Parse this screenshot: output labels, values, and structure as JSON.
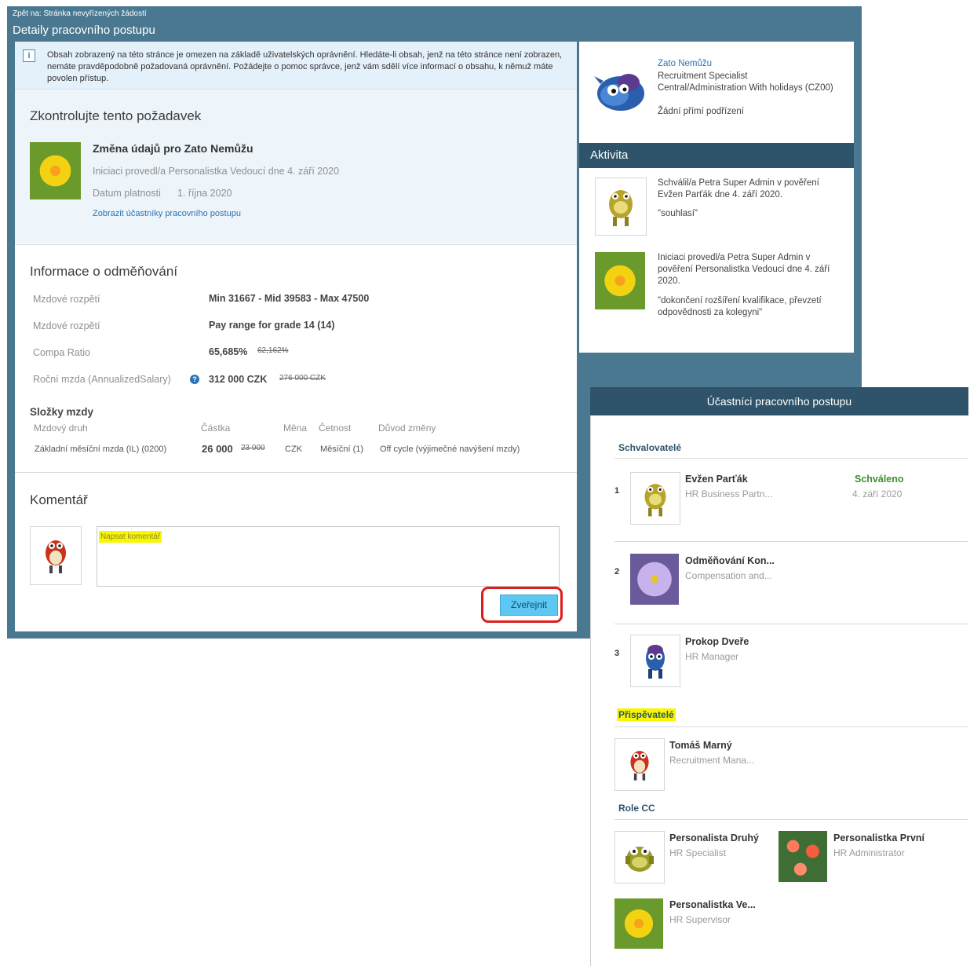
{
  "header": {
    "back": "Zpět na: Stránka nevyřízených žádostí",
    "title": "Detaily pracovního postupu"
  },
  "info": {
    "text": "Obsah zobrazený na této stránce je omezen na základě uživatelských oprávnění. Hledáte-li obsah, jenž na této stránce není zobrazen, nemáte pravděpodobně požadovaná oprávnění. Požádejte o pomoc správce, jenž vám sdělí více informací o obsahu, k němuž máte povolen přístup."
  },
  "review": {
    "title": "Zkontrolujte tento požadavek",
    "request": "Změna údajů pro Zato Nemůžu",
    "initiated": "Iniciaci provedl/a Personalistka Vedoucí dne 4. září 2020",
    "date_label": "Datum platnosti",
    "date_value": "1. října 2020",
    "link": "Zobrazit účastníky pracovního postupu"
  },
  "comp": {
    "title": "Informace o odměňování",
    "rows": [
      {
        "label": "Mzdové rozpětí",
        "value": "Min 31667 - Mid 39583 - Max 47500",
        "old": ""
      },
      {
        "label": "Mzdové rozpětí",
        "value": "Pay range for grade 14 (14)",
        "old": ""
      },
      {
        "label": "Compa Ratio",
        "value": "65,685%",
        "old": "62,162%"
      },
      {
        "label": "Roční mzda (AnnualizedSalary)",
        "value": "312 000 CZK",
        "old": "276 000 CZK"
      }
    ],
    "components_title": "Složky mzdy",
    "columns": [
      "Mzdový druh",
      "Částka",
      "Měna",
      "Četnost",
      "Důvod změny"
    ],
    "row": {
      "type": "Základní měsíční mzda (IL) (0200)",
      "amount": "26 000",
      "amount_old": "23 000",
      "currency": "CZK",
      "freq": "Měsíční (1)",
      "reason": "Off cycle (výjimečné navýšení mzdy)"
    }
  },
  "comment": {
    "title": "Komentář",
    "placeholder": "Napsat komentář",
    "publish": "Zveřejnit"
  },
  "profile": {
    "name": "Zato Nemůžu",
    "role": "Recruitment Specialist",
    "dept": "Central/Administration With holidays (CZ00)",
    "reports": "Žádní přímí podřízení"
  },
  "activity": {
    "title": "Aktivita",
    "items": [
      {
        "text": "Schválil/a Petra Super Admin v pověření Evžen Parťák dne 4. září 2020.",
        "quote": "\"souhlasí\""
      },
      {
        "text": "Iniciaci provedl/a Petra Super Admin v pověření Personalistka Vedoucí dne 4. září 2020.",
        "quote": "\"dokončení rozšíření kvalifikace, převzetí odpovědnosti za kolegyni\""
      }
    ]
  },
  "participants": {
    "title": "Účastníci pracovního postupu",
    "approvers_label": "Schvalovatelé",
    "approvers": [
      {
        "num": "1",
        "name": "Evžen Parťák",
        "role": "HR Business Partn...",
        "status": "Schváleno",
        "date": "4. září 2020"
      },
      {
        "num": "2",
        "name": "Odměňování Kon...",
        "role": "Compensation and...",
        "status": "",
        "date": ""
      },
      {
        "num": "3",
        "name": "Prokop Dveře",
        "role": "HR Manager",
        "status": "",
        "date": ""
      }
    ],
    "contributors_label": "Přispěvatelé",
    "contributors": [
      {
        "name": "Tomáš Marný",
        "role": "Recruitment Mana..."
      }
    ],
    "cc_label": "Role CC",
    "cc": [
      {
        "name": "Personalista Druhý",
        "role": "HR Specialist"
      },
      {
        "name": "Personalistka První",
        "role": "HR Administrator"
      },
      {
        "name": "Personalistka Ve...",
        "role": "HR Supervisor"
      }
    ]
  },
  "colors": {
    "header": "#4a7890",
    "dark": "#2e536a",
    "approved": "#3e8e2f",
    "publish_bg": "#5ec8f2",
    "highlight_ring": "#e01b1b"
  }
}
